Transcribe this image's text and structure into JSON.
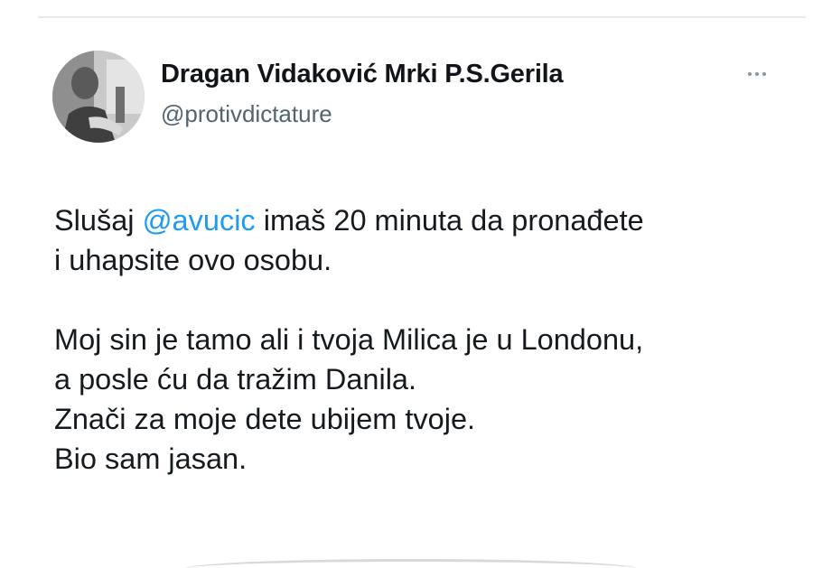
{
  "post": {
    "author": {
      "display_name": "Dragan Vidaković Mrki P.S.Gerila",
      "handle": "@protivdictature"
    },
    "more_icon": "more-horizontal-icon",
    "text": {
      "paragraph1": {
        "line1_prefix": "Slušaj ",
        "mention": "@avucic",
        "line1_suffix": " imaš 20 minuta da pronađete",
        "line2": "i uhapsite ovo osobu."
      },
      "paragraph2": {
        "line1": "Moj sin je tamo ali i tvoja Milica je u Londonu,",
        "line2": "a posle ću da tražim Danila.",
        "line3": "Znači za moje dete ubijem tvoje.",
        "line4": "Bio sam jasan."
      }
    }
  },
  "colors": {
    "mention": "#1d9bf0",
    "handle": "#536471",
    "text": "#0f1419"
  }
}
